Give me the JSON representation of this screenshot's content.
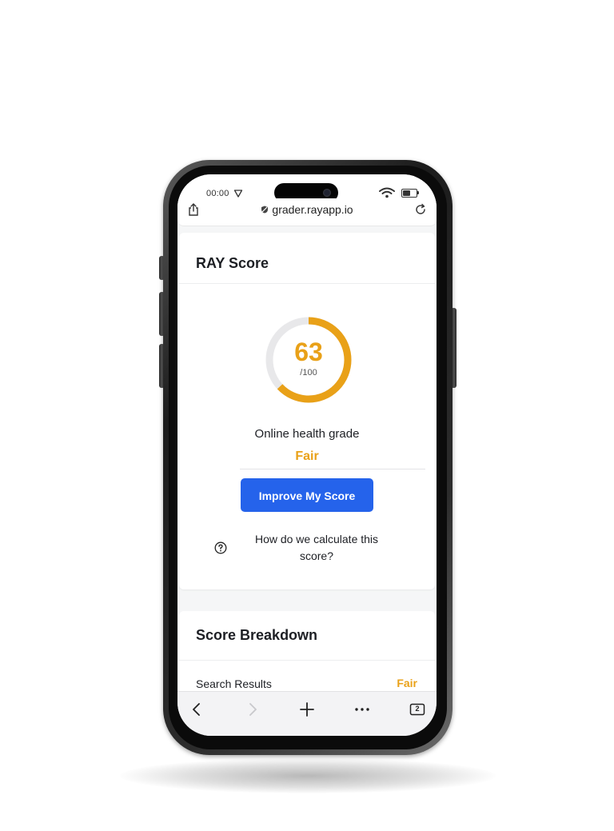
{
  "status_bar": {
    "time": "00:00"
  },
  "browser": {
    "url": "grader.rayapp.io",
    "tab_count": "2",
    "icons": [
      "share-icon",
      "lock-icon",
      "reload-icon",
      "back-icon",
      "forward-icon",
      "add-tab-icon",
      "more-icon",
      "tabs-icon"
    ]
  },
  "score_card": {
    "title": "RAY Score",
    "score": "63",
    "max_label": "/100",
    "score_fraction": 0.63,
    "grade_label": "Online health grade",
    "grade_value": "Fair",
    "button_label": "Improve My Score",
    "help_text": "How do we calculate this score?"
  },
  "breakdown": {
    "title": "Score Breakdown",
    "rows": [
      {
        "label": "Search Results",
        "value": "Fair"
      }
    ]
  },
  "colors": {
    "accent": "#e9a118",
    "button": "#2563eb",
    "track": "#e8e8ea"
  }
}
